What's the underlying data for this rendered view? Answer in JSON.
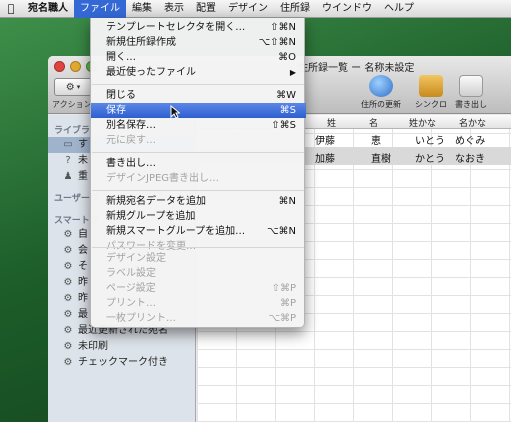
{
  "menubar": {
    "app": "宛名職人",
    "items": [
      "ファイル",
      "編集",
      "表示",
      "配置",
      "デザイン",
      "住所録",
      "ウインドウ",
      "ヘルプ"
    ]
  },
  "window": {
    "title": "住所録一覧 ー 名称未設定",
    "action_label": "アクション",
    "toolbar": {
      "update": "住所の更新",
      "sync": "シンクロ",
      "export": "書き出し"
    }
  },
  "sidebar": {
    "library_head": "ライブラ",
    "items_lib": [
      "す",
      "未",
      "重"
    ],
    "user_head": "ユーザーグ",
    "smart_head": "スマートグ",
    "smart_items": [
      "自",
      "会",
      "そ",
      "昨",
      "昨",
      "最",
      "最近更新された宛名",
      "未印刷",
      "チェックマーク付き"
    ]
  },
  "table": {
    "headers": [
      "姓",
      "名",
      "姓かな",
      "名かな"
    ],
    "rows": [
      [
        "伊藤",
        "恵",
        "いとう",
        "めぐみ"
      ],
      [
        "加藤",
        "直樹",
        "かとう",
        "なおき"
      ]
    ]
  },
  "file_menu": {
    "items": [
      {
        "label": "テンプレートセレクタを開く…",
        "shortcut": "⇧⌘N",
        "enabled": true
      },
      {
        "label": "新規住所録作成",
        "shortcut": "⌥⇧⌘N",
        "enabled": true
      },
      {
        "label": "開く…",
        "shortcut": "⌘O",
        "enabled": true
      },
      {
        "label": "最近使ったファイル",
        "shortcut": "▶",
        "enabled": true
      },
      {
        "label": "閉じる",
        "shortcut": "⌘W",
        "enabled": true
      },
      {
        "label": "保存",
        "shortcut": "⌘S",
        "enabled": true,
        "highlighted": true
      },
      {
        "label": "別名保存…",
        "shortcut": "⇧⌘S",
        "enabled": true
      },
      {
        "label": "元に戻す…",
        "shortcut": "",
        "enabled": false
      },
      {
        "label": "書き出し…",
        "shortcut": "",
        "enabled": true
      },
      {
        "label": "デザインJPEG書き出し…",
        "shortcut": "",
        "enabled": false
      },
      {
        "label": "新規宛名データを追加",
        "shortcut": "⌘N",
        "enabled": true
      },
      {
        "label": "新規グループを追加",
        "shortcut": "",
        "enabled": true
      },
      {
        "label": "新規スマートグループを追加…",
        "shortcut": "⌥⌘N",
        "enabled": true
      },
      {
        "label": "パスワードを変更…",
        "shortcut": "",
        "enabled": false
      },
      {
        "label": "デザイン設定",
        "shortcut": "",
        "enabled": false
      },
      {
        "label": "ラベル設定",
        "shortcut": "",
        "enabled": false
      },
      {
        "label": "ページ設定",
        "shortcut": "⇧⌘P",
        "enabled": false
      },
      {
        "label": "プリント…",
        "shortcut": "⌘P",
        "enabled": false
      },
      {
        "label": "一枚プリント…",
        "shortcut": "⌥⌘P",
        "enabled": false
      }
    ]
  },
  "colors": {
    "menu_highlight": "#3469d5",
    "sidebar_bg": "#dde3ea",
    "selected_row": "#d9d9d9"
  }
}
